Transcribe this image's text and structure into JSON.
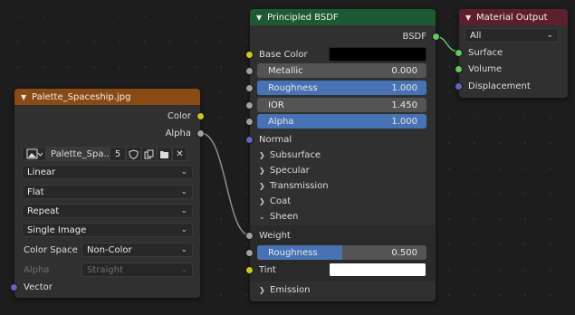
{
  "colors": {
    "background": "#1d1d1d",
    "node_body": "#303030",
    "header_image": "#8a4a14",
    "header_bsdf": "#1d5a32",
    "header_output": "#5c1f2c",
    "slider_fill": "#4772b3",
    "socket_color": "#c7c729",
    "socket_float": "#a1a1a1",
    "socket_shader": "#63c763",
    "socket_vector": "#6363c7"
  },
  "image_node": {
    "title": "Palette_Spaceship.jpg",
    "outputs": {
      "color": "Color",
      "alpha": "Alpha"
    },
    "image_name": "Palette_Spa...",
    "users": "5",
    "interpolation": "Linear",
    "projection": "Flat",
    "extension": "Repeat",
    "source": "Single Image",
    "color_space_label": "Color Space",
    "color_space": "Non-Color",
    "alpha_label": "Alpha",
    "alpha_mode": "Straight",
    "vector_label": "Vector"
  },
  "bsdf_node": {
    "title": "Principled BSDF",
    "output": "BSDF",
    "base_color_label": "Base Color",
    "base_color": "#000000",
    "metallic": {
      "label": "Metallic",
      "value": "0.000",
      "fraction": 0
    },
    "roughness": {
      "label": "Roughness",
      "value": "1.000",
      "fraction": 1
    },
    "ior": {
      "label": "IOR",
      "value": "1.450",
      "fraction": 0
    },
    "alpha": {
      "label": "Alpha",
      "value": "1.000",
      "fraction": 1
    },
    "normal_label": "Normal",
    "panels": [
      "Subsurface",
      "Specular",
      "Transmission",
      "Coat"
    ],
    "sheen_label": "Sheen",
    "weight_label": "Weight",
    "sheen_roughness": {
      "label": "Roughness",
      "value": "0.500",
      "fraction": 0.5
    },
    "tint_label": "Tint",
    "tint_color": "#ffffff",
    "emission_label": "Emission"
  },
  "output_node": {
    "title": "Material Output",
    "target": "All",
    "inputs": {
      "surface": "Surface",
      "volume": "Volume",
      "displacement": "Displacement"
    }
  }
}
